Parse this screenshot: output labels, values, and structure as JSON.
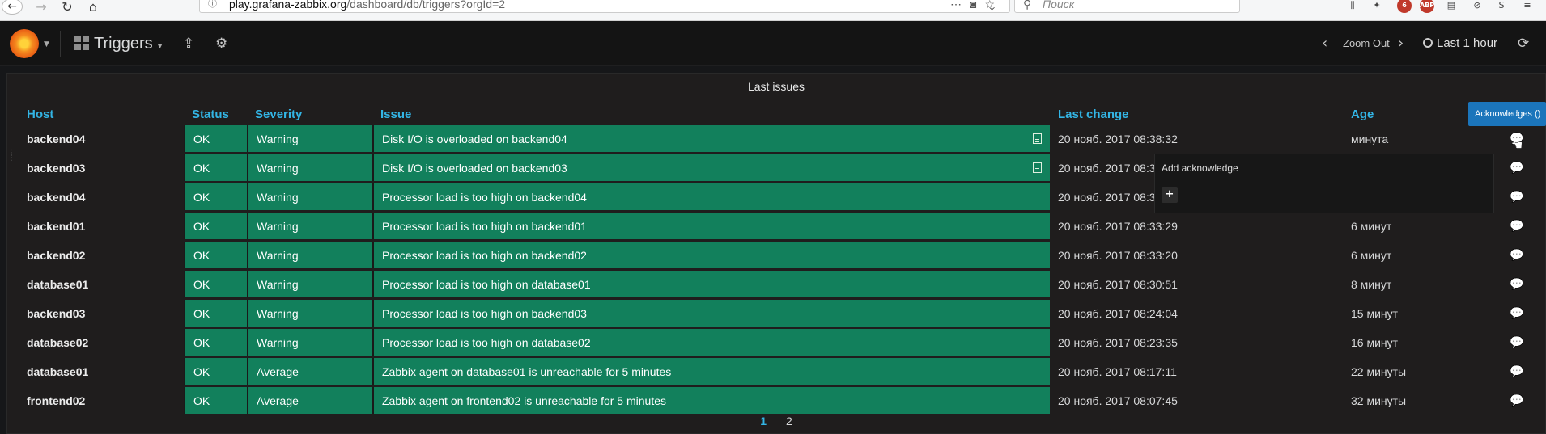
{
  "browser": {
    "url_host": "play.grafana-zabbix.org",
    "url_path": "/dashboard/db/triggers?orgId=2",
    "search_placeholder": "Поиск",
    "ext_badge": "6",
    "abp": "ABP"
  },
  "navbar": {
    "dashboard_title": "Triggers",
    "zoom_out": "Zoom Out",
    "time_range": "Last 1 hour"
  },
  "panel": {
    "title": "Last issues",
    "columns": [
      "Host",
      "Status",
      "Severity",
      "Issue",
      "Last change",
      "Age"
    ],
    "rows": [
      {
        "host": "backend04",
        "status": "OK",
        "severity": "Warning",
        "issue": "Disk I/O is overloaded on backend04",
        "last_change": "20 нояб. 2017 08:38:32",
        "age": "минута",
        "has_doc": true
      },
      {
        "host": "backend03",
        "status": "OK",
        "severity": "Warning",
        "issue": "Disk I/O is overloaded on backend03",
        "last_change": "20 нояб. 2017 08:3",
        "age": "",
        "has_doc": true
      },
      {
        "host": "backend04",
        "status": "OK",
        "severity": "Warning",
        "issue": "Processor load is too high on backend04",
        "last_change": "20 нояб. 2017 08:3",
        "age": "",
        "has_doc": false
      },
      {
        "host": "backend01",
        "status": "OK",
        "severity": "Warning",
        "issue": "Processor load is too high on backend01",
        "last_change": "20 нояб. 2017 08:33:29",
        "age": "6 минут",
        "has_doc": false
      },
      {
        "host": "backend02",
        "status": "OK",
        "severity": "Warning",
        "issue": "Processor load is too high on backend02",
        "last_change": "20 нояб. 2017 08:33:20",
        "age": "6 минут",
        "has_doc": false
      },
      {
        "host": "database01",
        "status": "OK",
        "severity": "Warning",
        "issue": "Processor load is too high on database01",
        "last_change": "20 нояб. 2017 08:30:51",
        "age": "8 минут",
        "has_doc": false
      },
      {
        "host": "backend03",
        "status": "OK",
        "severity": "Warning",
        "issue": "Processor load is too high on backend03",
        "last_change": "20 нояб. 2017 08:24:04",
        "age": "15 минут",
        "has_doc": false
      },
      {
        "host": "database02",
        "status": "OK",
        "severity": "Warning",
        "issue": "Processor load is too high on database02",
        "last_change": "20 нояб. 2017 08:23:35",
        "age": "16 минут",
        "has_doc": false
      },
      {
        "host": "database01",
        "status": "OK",
        "severity": "Average",
        "issue": "Zabbix agent on database01 is unreachable for 5 minutes",
        "last_change": "20 нояб. 2017 08:17:11",
        "age": "22 минуты",
        "has_doc": false
      },
      {
        "host": "frontend02",
        "status": "OK",
        "severity": "Average",
        "issue": "Zabbix agent on frontend02 is unreachable for 5 minutes",
        "last_change": "20 нояб. 2017 08:07:45",
        "age": "32 минуты",
        "has_doc": false
      }
    ],
    "pages": [
      "1",
      "2"
    ],
    "active_page": "1"
  },
  "tooltip": {
    "text": "Acknowledges ()"
  },
  "ack_popup": {
    "title": "Add acknowledge",
    "add_label": "+"
  },
  "colors": {
    "ok_green": "#12805c",
    "header_blue": "#33b5e5",
    "tooltip_blue": "#1b75bb"
  },
  "icons": [
    "info-icon",
    "more-icon",
    "pocket-icon",
    "star-icon",
    "download-icon",
    "search-icon",
    "library-icon",
    "grafana-logo-icon",
    "share-icon",
    "gear-icon",
    "chevron-left-icon",
    "chevron-right-icon",
    "clock-icon",
    "refresh-icon",
    "document-icon",
    "comments-icon",
    "plus-icon"
  ]
}
